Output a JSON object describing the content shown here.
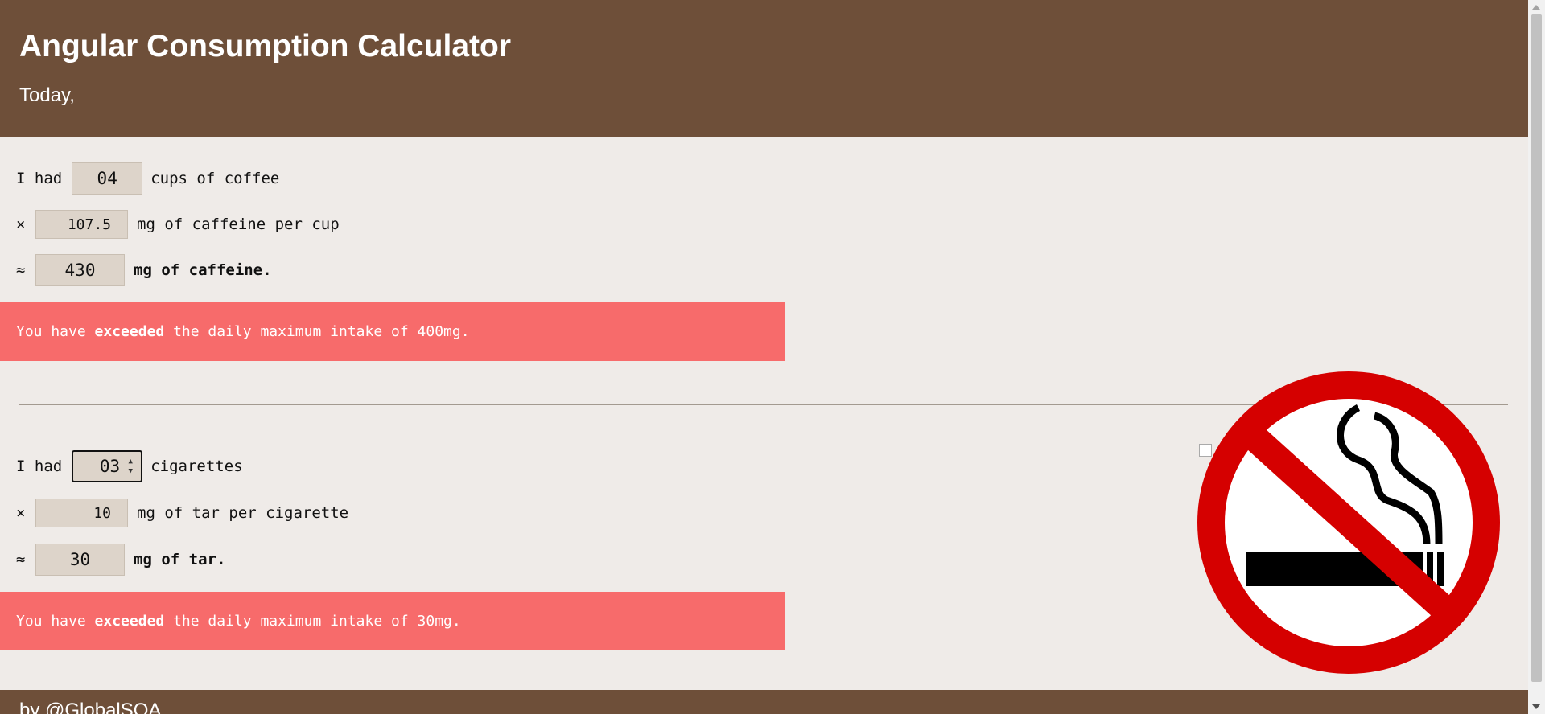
{
  "header": {
    "title": "Angular Consumption Calculator",
    "subtitle": "Today,"
  },
  "coffee": {
    "prefix": "I had",
    "cups_value": "04",
    "cups_label": "cups of coffee",
    "multiply_symbol": "×",
    "caffeine_per_cup_value": "107.5",
    "caffeine_per_cup_label": "mg of caffeine per cup",
    "approx_symbol": "≈",
    "total_value": "430",
    "total_label": "mg of caffeine.",
    "alert": {
      "before": "You have ",
      "emphasis": "exceeded",
      "after": " the daily maximum intake of 400mg."
    }
  },
  "cigarettes": {
    "prefix": "I had",
    "count_value": "03",
    "count_label": "cigarettes",
    "multiply_symbol": "×",
    "tar_per_cigarette_value": "10",
    "tar_per_cigarette_label": "mg of tar per cigarette",
    "approx_symbol": "≈",
    "total_value": "30",
    "total_label": "mg of tar.",
    "alert": {
      "before": "You have ",
      "emphasis": "exceeded",
      "after": " the daily maximum intake of 30mg."
    }
  },
  "footer": {
    "text": "by  @GlobalSQA"
  },
  "icons": {
    "no_smoking": "no-smoking-icon",
    "spinner": "spinner-arrows-icon",
    "broken_image": "broken-image-icon"
  },
  "colors": {
    "header_bg": "#6e4f39",
    "page_bg": "#efebe8",
    "input_bg": "#ddd4ca",
    "alert_bg": "#f76b6b",
    "no_smoking_red": "#d50000"
  }
}
